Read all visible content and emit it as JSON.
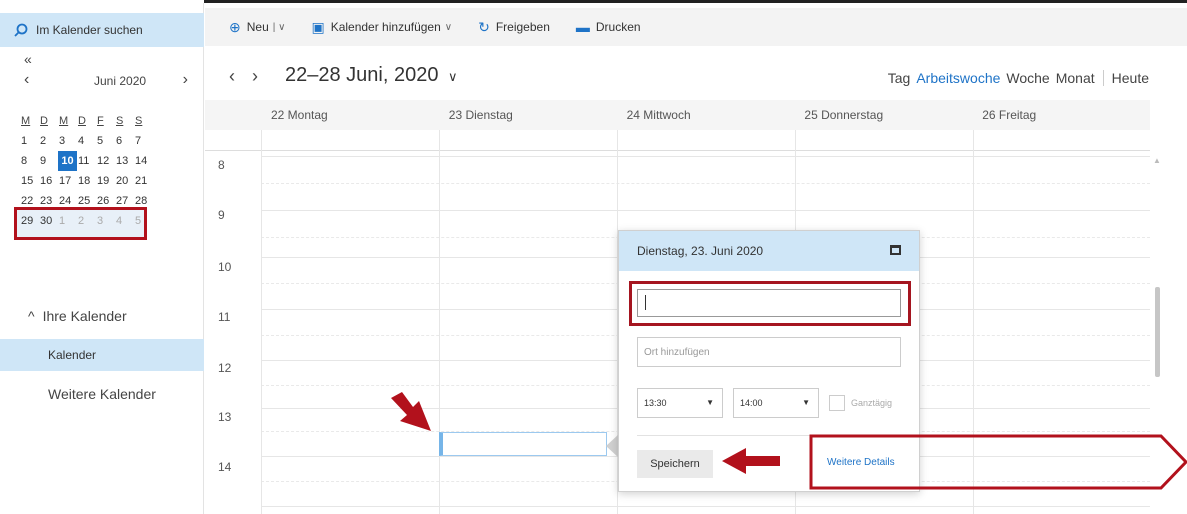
{
  "sidebar": {
    "search_placeholder": "Im Kalender suchen",
    "collapse_label": "«",
    "mini_calendar": {
      "prev": "‹",
      "next": "›",
      "month": "Juni 2020",
      "weekdays": [
        "M",
        "D",
        "M",
        "D",
        "F",
        "S",
        "S"
      ],
      "weeks": [
        [
          "1",
          "2",
          "3",
          "4",
          "5",
          "6",
          "7"
        ],
        [
          "8",
          "9",
          "10",
          "11",
          "12",
          "13",
          "14"
        ],
        [
          "15",
          "16",
          "17",
          "18",
          "19",
          "20",
          "21"
        ],
        [
          "22",
          "23",
          "24",
          "25",
          "26",
          "27",
          "28"
        ],
        [
          "29",
          "30",
          "1",
          "2",
          "3",
          "4",
          "5"
        ]
      ],
      "today": "10"
    },
    "ihre_kalender": "Ihre Kalender",
    "ihre_chevron": "^",
    "calendar_item": "Kalender",
    "weitere_kalender": "Weitere Kalender"
  },
  "toolbar": {
    "neu": "Neu",
    "kalender_hinzufuegen": "Kalender hinzufügen",
    "freigeben": "Freigeben",
    "drucken": "Drucken"
  },
  "nav": {
    "prev": "‹",
    "next": "›",
    "range": "22–28 Juni, 2020",
    "views": {
      "tag": "Tag",
      "arbeitswoche": "Arbeitswoche",
      "woche": "Woche",
      "monat": "Monat",
      "heute": "Heute"
    }
  },
  "day_headers": [
    "22 Montag",
    "23 Dienstag",
    "24 Mittwoch",
    "25 Donnerstag",
    "26 Freitag"
  ],
  "hours": [
    "8",
    "9",
    "10",
    "11",
    "12",
    "13",
    "14"
  ],
  "popup": {
    "date": "Dienstag, 23. Juni 2020",
    "title_value": "",
    "location_placeholder": "Ort hinzufügen",
    "start_time": "13:30",
    "end_time": "14:00",
    "all_day": "Ganztägig",
    "save": "Speichern",
    "more_details": "Weitere Details"
  },
  "colors": {
    "accent": "#1e73c7",
    "highlight": "#cfe6f7",
    "annotation": "#b2111c"
  }
}
